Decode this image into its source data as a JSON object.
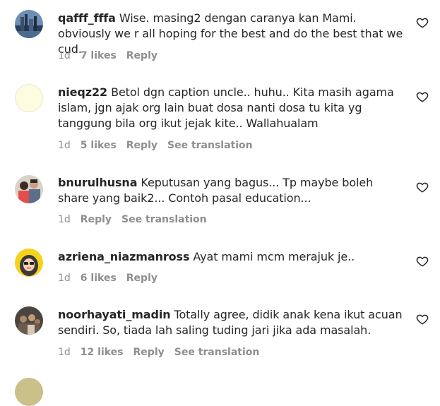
{
  "comments": [
    {
      "username": "qafff_fffa",
      "text": "Wise. masing2 dengan caranya kan Mami. obviously we r all hoping for the best and do the best that we cud.",
      "time": "1d",
      "likes": "7 likes",
      "reply": "Reply",
      "avatar_icon": "city-skyline-avatar"
    },
    {
      "username": "nieqz22",
      "text": "Betol dgn caption uncle.. huhu.. Kita masih agama islam, jgn ajak org lain buat dosa nanti dosa tu kita yg tanggung bila org ikut jejak kite.. Wallahualam",
      "time": "1d",
      "likes": "5 likes",
      "reply": "Reply",
      "translate": "See translation",
      "avatar_icon": "pale-yellow-avatar"
    },
    {
      "username": "bnurulhusna",
      "text": "Keputusan yang bagus... Tp maybe boleh share yang baik2... Contoh pasal education...",
      "time": "1d",
      "reply": "Reply",
      "translate": "See translation",
      "avatar_icon": "family-photo-avatar"
    },
    {
      "username": "azriena_niazmanross",
      "text": "Ayat mami mcm merajuk je..",
      "time": "1d",
      "likes": "6 likes",
      "reply": "Reply",
      "avatar_icon": "cartoon-hijab-avatar"
    },
    {
      "username": "noorhayati_madin",
      "text": "Totally agree, didik anak kena ikut acuan sendiri. So, tiada lah saling tuding jari jika ada masalah.",
      "time": "1d",
      "likes": "12 likes",
      "reply": "Reply",
      "translate": "See translation",
      "avatar_icon": "group-photo-avatar"
    }
  ],
  "colors": {
    "text": "#262626",
    "meta": "#8e8e8e",
    "heart_stroke": "#262626"
  }
}
